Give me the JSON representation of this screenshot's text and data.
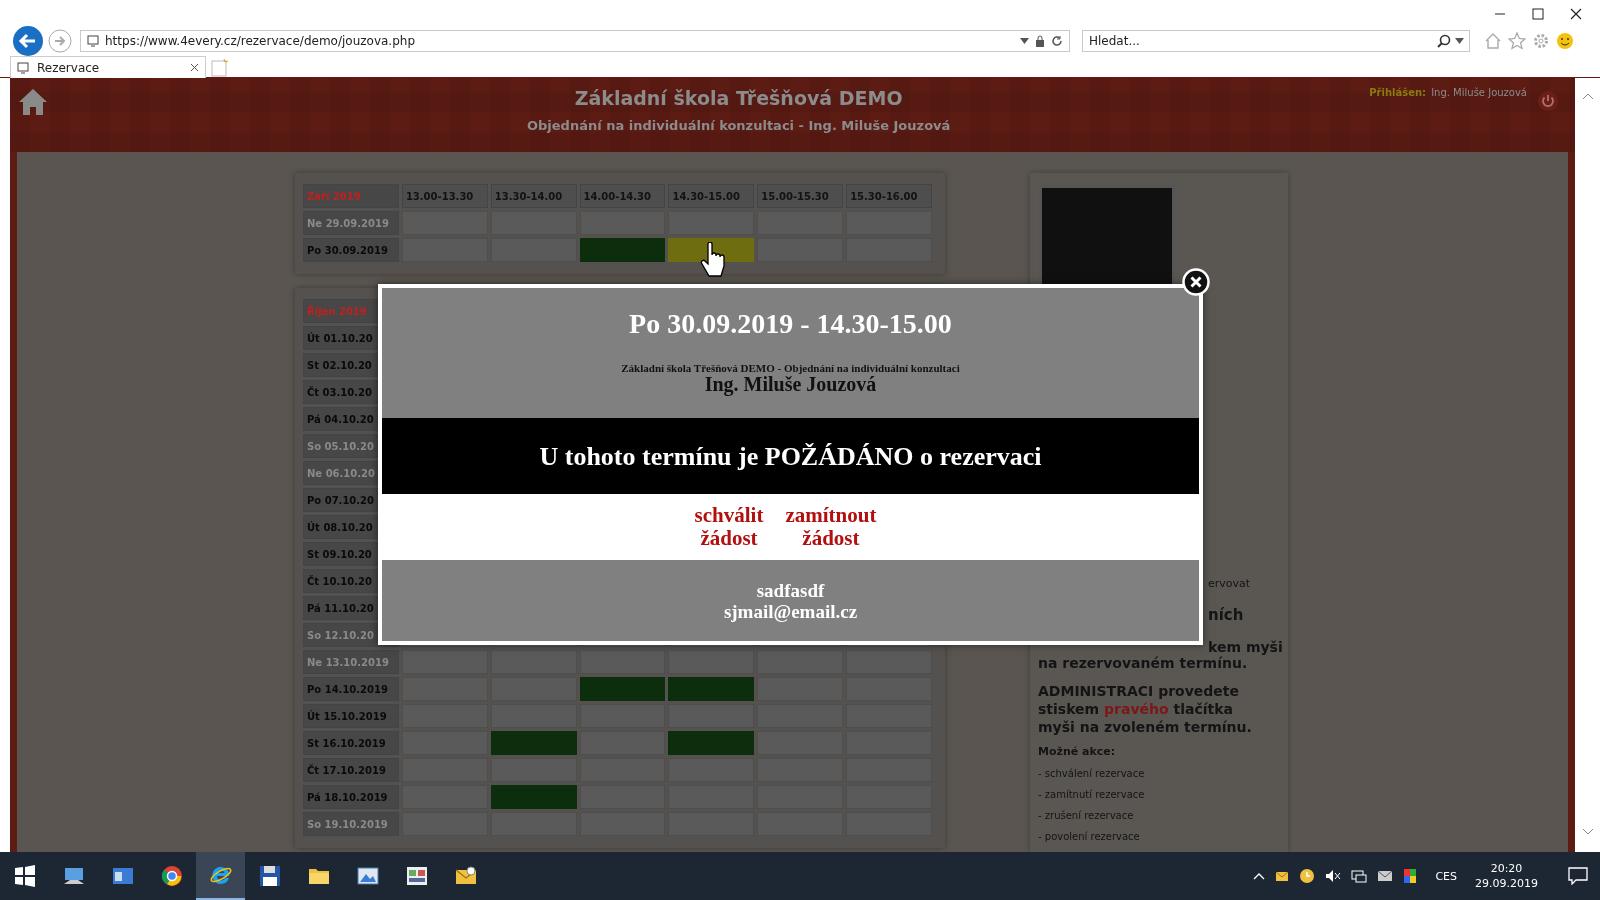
{
  "browser": {
    "address": "https://www.4every.cz/rezervace/demo/jouzova.php",
    "search_placeholder": "Hledat...",
    "tabs": [
      {
        "label": "Rezervace",
        "selected": true
      }
    ]
  },
  "header": {
    "title": "Základní škola Třešňová DEMO",
    "subtitle": "Objednání na individuální konzultaci - Ing. Miluše Jouzová",
    "login_label": "Přihlášen:",
    "login_user": "Ing. Miluše Jouzová"
  },
  "calendars": [
    {
      "month": "Září 2019",
      "times": [
        "13.00-13.30",
        "13.30-14.00",
        "14.00-14.30",
        "14.30-15.00",
        "15.00-15.30",
        "15.30-16.00"
      ],
      "rows": [
        {
          "date": "Ne 29.09.2019",
          "weekend": true,
          "slots": [
            {
              "kind": "free"
            },
            {
              "kind": "free"
            },
            {
              "kind": "free"
            },
            {
              "kind": "free"
            },
            {
              "kind": "free"
            },
            {
              "kind": "free"
            }
          ]
        },
        {
          "date": "Po 30.09.2019",
          "weekend": false,
          "slots": [
            {
              "kind": "free"
            },
            {
              "kind": "free"
            },
            {
              "kind": "booked"
            },
            {
              "kind": "requested"
            },
            {
              "kind": "free"
            },
            {
              "kind": "free"
            }
          ]
        }
      ]
    },
    {
      "month": "Říjen 2019",
      "rows": [
        {
          "date": "Út 01.10.20",
          "weekend": false
        },
        {
          "date": "St 02.10.20",
          "weekend": false
        },
        {
          "date": "Čt 03.10.20",
          "weekend": false
        },
        {
          "date": "Pá 04.10.20",
          "weekend": false
        },
        {
          "date": "So 05.10.20",
          "weekend": true
        },
        {
          "date": "Ne 06.10.20",
          "weekend": true
        },
        {
          "date": "Po 07.10.20",
          "weekend": false
        },
        {
          "date": "Út 08.10.20",
          "weekend": false
        },
        {
          "date": "St 09.10.20",
          "weekend": false
        },
        {
          "date": "Čt 10.10.20",
          "weekend": false
        },
        {
          "date": "Pá 11.10.20",
          "weekend": false
        },
        {
          "date": "So 12.10.20",
          "weekend": true
        },
        {
          "date": "Ne 13.10.2019",
          "weekend": true,
          "slots": [
            {
              "kind": "free"
            },
            {
              "kind": "free"
            },
            {
              "kind": "free"
            },
            {
              "kind": "free"
            },
            {
              "kind": "free"
            },
            {
              "kind": "free"
            }
          ]
        },
        {
          "date": "Po 14.10.2019",
          "weekend": false,
          "slots": [
            {
              "kind": "free"
            },
            {
              "kind": "free"
            },
            {
              "kind": "booked"
            },
            {
              "kind": "booked"
            },
            {
              "kind": "free"
            },
            {
              "kind": "free"
            }
          ]
        },
        {
          "date": "Út 15.10.2019",
          "weekend": false,
          "slots": [
            {
              "kind": "free"
            },
            {
              "kind": "free"
            },
            {
              "kind": "free"
            },
            {
              "kind": "free"
            },
            {
              "kind": "free"
            },
            {
              "kind": "free"
            }
          ]
        },
        {
          "date": "St 16.10.2019",
          "weekend": false,
          "slots": [
            {
              "kind": "free"
            },
            {
              "kind": "booked"
            },
            {
              "kind": "free"
            },
            {
              "kind": "booked"
            },
            {
              "kind": "free"
            },
            {
              "kind": "free"
            }
          ]
        },
        {
          "date": "Čt 17.10.2019",
          "weekend": false,
          "slots": [
            {
              "kind": "free"
            },
            {
              "kind": "free"
            },
            {
              "kind": "free"
            },
            {
              "kind": "free"
            },
            {
              "kind": "free"
            },
            {
              "kind": "free"
            }
          ]
        },
        {
          "date": "Pá 18.10.2019",
          "weekend": false,
          "slots": [
            {
              "kind": "free"
            },
            {
              "kind": "booked"
            },
            {
              "kind": "free"
            },
            {
              "kind": "free"
            },
            {
              "kind": "free"
            },
            {
              "kind": "free"
            }
          ]
        },
        {
          "date": "So 19.10.2019",
          "weekend": true,
          "slots": [
            {
              "kind": "free"
            },
            {
              "kind": "free"
            },
            {
              "kind": "free"
            },
            {
              "kind": "free"
            },
            {
              "kind": "free"
            },
            {
              "kind": "free"
            }
          ]
        }
      ]
    }
  ],
  "info_panel": {
    "note_fragment": "ervovat",
    "heading_fragment": "ních",
    "text_fragment": "kem myši",
    "text_continuation": "na rezervovaném termínu.",
    "admin_text": "ADMINISTRACI provedete stiskem **pravého** tlačítka myši na zvoleném termínu.",
    "actions_heading": "Možné akce:",
    "actions": [
      "- schválení rezervace",
      "- zamítnutí rezervace",
      "- zrušení rezervace",
      "- povolení rezervace"
    ]
  },
  "modal": {
    "title": "Po 30.09.2019 - 14.30-15.00",
    "context": "Základní škola Třešňová DEMO - Objednání na individuální konzultaci",
    "teacher": "Ing. Miluše Jouzová",
    "status": "U tohoto termínu je POŽÁDÁNO o rezervaci",
    "actions": [
      "schválit žádost",
      "zamítnout žádost"
    ],
    "requester_name": "sadfasdf",
    "requester_email": "sjmail@email.cz"
  },
  "taskbar": {
    "language": "CES",
    "time": "20:20",
    "date": "29.09.2019"
  }
}
